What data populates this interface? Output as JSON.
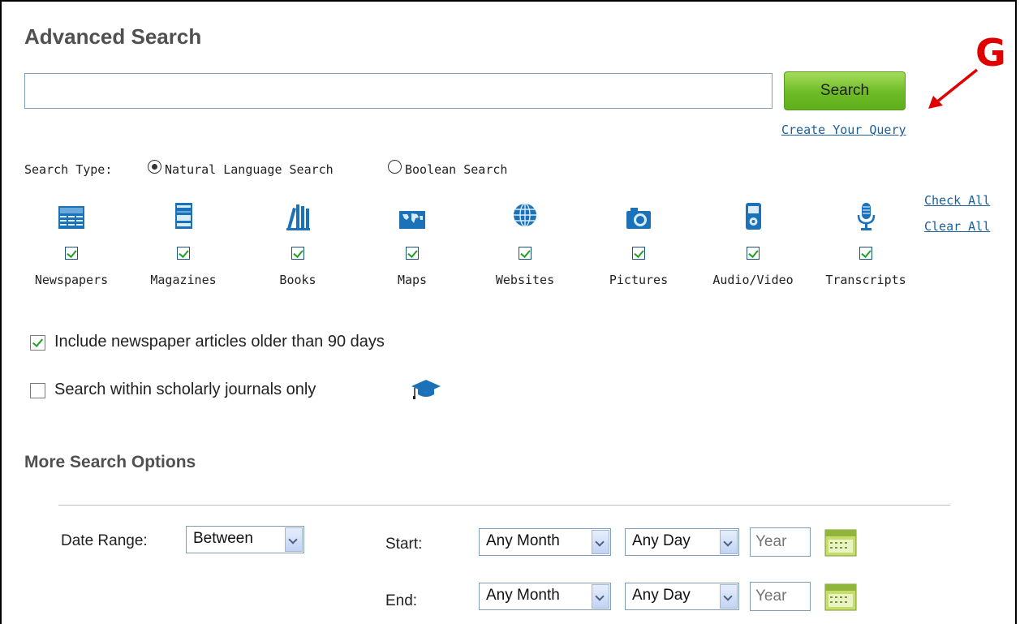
{
  "header": {
    "title": "Advanced Search"
  },
  "search": {
    "value": "",
    "button_label": "Search",
    "create_query_link": "Create Your Query"
  },
  "annotation": {
    "letter": "G",
    "color": "#e00000"
  },
  "search_type": {
    "label": "Search Type:",
    "options": [
      {
        "label": "Natural Language Search",
        "selected": true
      },
      {
        "label": "Boolean Search",
        "selected": false
      }
    ]
  },
  "content_types": [
    {
      "label": "Newspapers",
      "icon": "newspaper-icon",
      "checked": true
    },
    {
      "label": "Magazines",
      "icon": "magazine-icon",
      "checked": true
    },
    {
      "label": "Books",
      "icon": "books-icon",
      "checked": true
    },
    {
      "label": "Maps",
      "icon": "map-icon",
      "checked": true
    },
    {
      "label": "Websites",
      "icon": "globe-icon",
      "checked": true
    },
    {
      "label": "Pictures",
      "icon": "camera-icon",
      "checked": true
    },
    {
      "label": "Audio/Video",
      "icon": "media-player-icon",
      "checked": true
    },
    {
      "label": "Transcripts",
      "icon": "microphone-icon",
      "checked": true
    }
  ],
  "bulk": {
    "check_all": "Check All",
    "clear_all": "Clear All"
  },
  "options": {
    "older_newspapers": {
      "label": "Include newspaper articles older than 90 days",
      "checked": true
    },
    "scholarly": {
      "label": "Search within scholarly journals only",
      "checked": false,
      "icon": "graduation-cap-icon"
    }
  },
  "more_options": {
    "title": "More Search Options",
    "date_range": {
      "label": "Date Range:",
      "value": "Between"
    },
    "start": {
      "label": "Start:",
      "month": "Any Month",
      "day": "Any Day",
      "year_placeholder": "Year",
      "icon": "calendar-icon"
    },
    "end": {
      "label": "End:",
      "month": "Any Month",
      "day": "Any Day",
      "year_placeholder": "Year",
      "icon": "calendar-icon"
    }
  },
  "colors": {
    "accent_link": "#1a5e9a",
    "search_button": "#6dbb25",
    "icon_blue": "#1b72b8"
  }
}
